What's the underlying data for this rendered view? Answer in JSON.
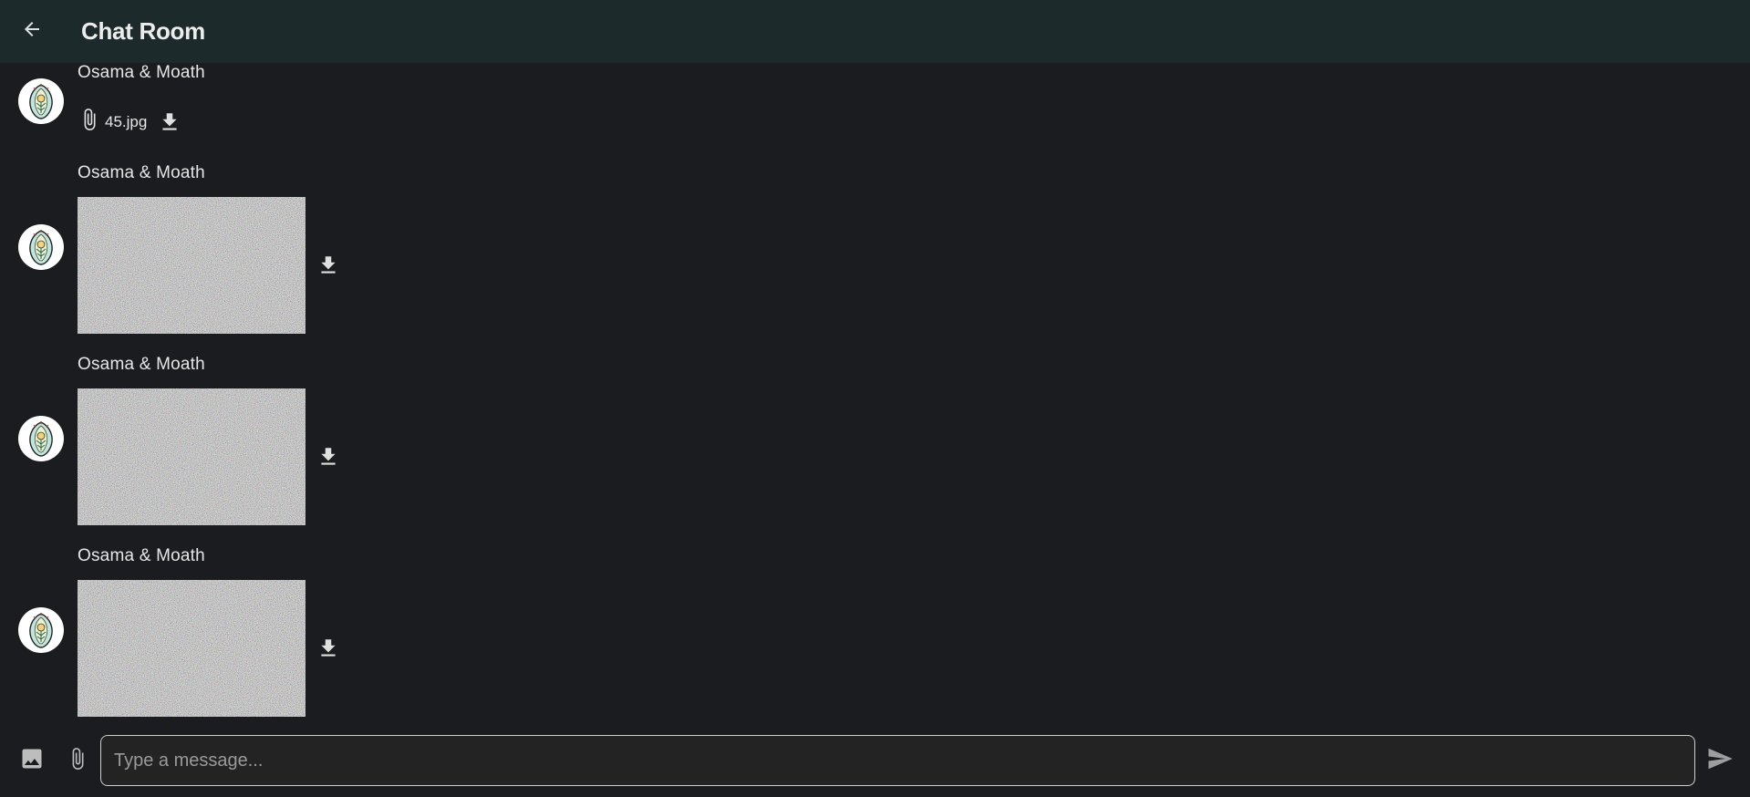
{
  "appbar": {
    "title": "Chat Room",
    "back_icon": "arrow-back-icon"
  },
  "messages": [
    {
      "sender": "Osama & Moath",
      "type": "file",
      "file_name": "45.jpg"
    },
    {
      "sender": "Osama & Moath",
      "type": "image"
    },
    {
      "sender": "Osama & Moath",
      "type": "image"
    },
    {
      "sender": "Osama & Moath",
      "type": "image"
    }
  ],
  "composer": {
    "placeholder": "Type a message...",
    "image_icon": "image-icon",
    "attach_icon": "paperclip-icon",
    "send_icon": "send-icon"
  },
  "colors": {
    "background": "#1a1c20",
    "appbar": "#1c2a2b",
    "text": "#e6e6e6"
  }
}
